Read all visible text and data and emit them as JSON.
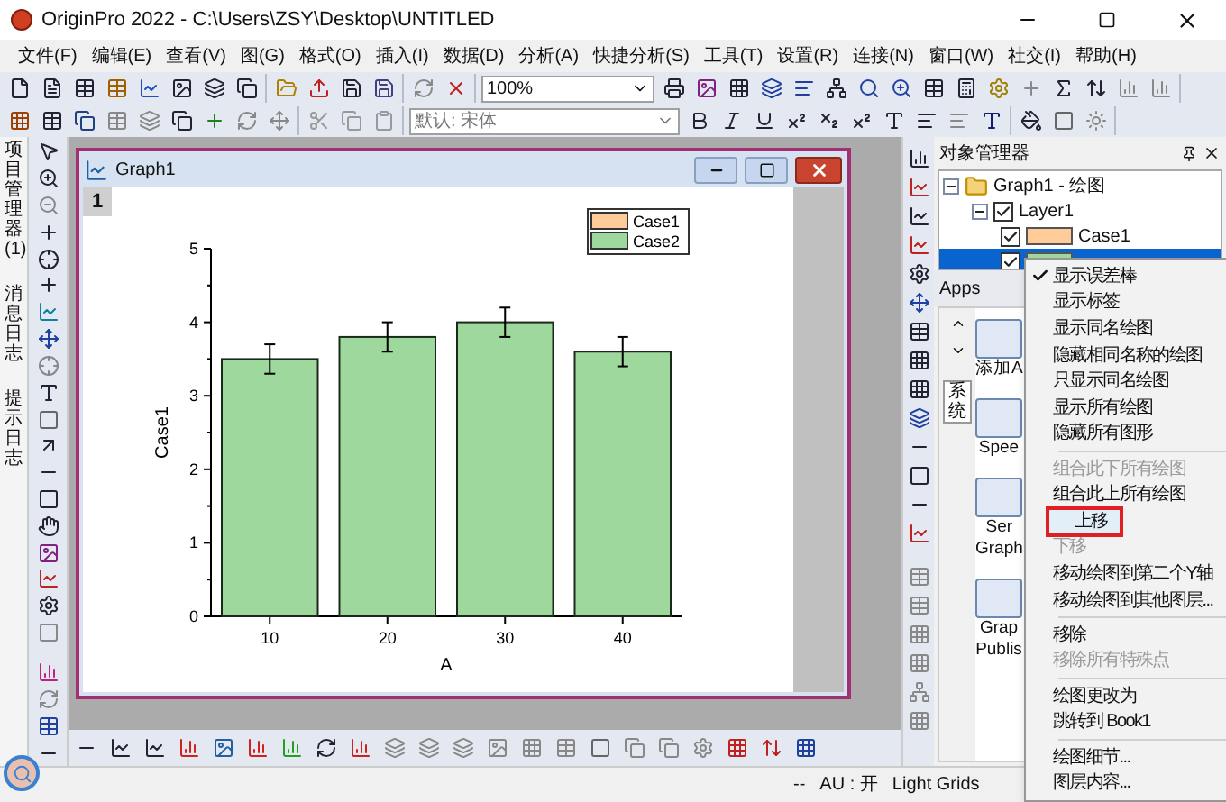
{
  "window": {
    "title": "OriginPro 2022 - C:\\Users\\ZSY\\Desktop\\UNTITLED"
  },
  "menu": [
    "文件(F)",
    "编辑(E)",
    "查看(V)",
    "图(G)",
    "格式(O)",
    "插入(I)",
    "数据(D)",
    "分析(A)",
    "快捷分析(S)",
    "工具(T)",
    "设置(R)",
    "连接(N)",
    "窗口(W)",
    "社交(I)",
    "帮助(H)"
  ],
  "toolbar": {
    "zoom": "100%",
    "font": "默认: 宋体"
  },
  "dock_tabs": [
    "项目管理器 (1)",
    "消息日志",
    "提示日志"
  ],
  "graph_window": {
    "title": "Graph1",
    "layer": "1",
    "chart_data": {
      "type": "bar",
      "xlabel": "A",
      "ylabel": "Case1",
      "categories": [
        "10",
        "20",
        "30",
        "40"
      ],
      "yticks": [
        0,
        1,
        2,
        3,
        4,
        5
      ],
      "ylim": [
        0,
        5
      ],
      "series": [
        {
          "name": "Case1",
          "color": "#ffcc99",
          "values": [
            null,
            null,
            null,
            null
          ]
        },
        {
          "name": "Case2",
          "color": "#9fd89c",
          "values": [
            3.5,
            3.8,
            4.0,
            3.6
          ],
          "errors": [
            0.2,
            0.2,
            0.2,
            0.2
          ]
        }
      ]
    }
  },
  "object_manager": {
    "title": "对象管理器",
    "tree": [
      {
        "label": "Graph1 - 绘图",
        "expanded": true,
        "children": [
          {
            "label": "Layer1",
            "checked": true,
            "expanded": true,
            "children": [
              {
                "label": "Case1",
                "checked": true,
                "color": "#ffcc99",
                "selected": false
              },
              {
                "checked": true,
                "color": "#9fd89c",
                "selected": true
              }
            ]
          }
        ]
      }
    ]
  },
  "apps": {
    "title": "Apps",
    "tab": "系统",
    "items": [
      {
        "lines": [
          "添加A"
        ]
      },
      {
        "lines": [
          "Spee"
        ]
      },
      {
        "lines": [
          "Ser",
          "Graph"
        ]
      },
      {
        "lines": [
          "Grap",
          "Publis"
        ]
      }
    ]
  },
  "context_menu": [
    {
      "kind": "item",
      "label": "显示误差棒",
      "checked": true,
      "disabled": false,
      "selected": false
    },
    {
      "kind": "item",
      "label": "显示标签",
      "checked": false,
      "disabled": false,
      "selected": false
    },
    {
      "kind": "item",
      "label": "显示同名绘图",
      "checked": false,
      "disabled": false,
      "selected": false
    },
    {
      "kind": "item",
      "label": "隐藏相同名称的绘图",
      "checked": false,
      "disabled": false,
      "selected": false
    },
    {
      "kind": "item",
      "label": "只显示同名绘图",
      "checked": false,
      "disabled": false,
      "selected": false
    },
    {
      "kind": "item",
      "label": "显示所有绘图",
      "checked": false,
      "disabled": false,
      "selected": false
    },
    {
      "kind": "item",
      "label": "隐藏所有图形",
      "checked": false,
      "disabled": false,
      "selected": false
    },
    {
      "kind": "separator"
    },
    {
      "kind": "item",
      "label": "组合此下所有绘图",
      "checked": false,
      "disabled": true,
      "selected": false
    },
    {
      "kind": "item",
      "label": "组合此上所有绘图",
      "checked": false,
      "disabled": false,
      "selected": false
    },
    {
      "kind": "item",
      "label": "上移",
      "checked": false,
      "disabled": false,
      "selected": true
    },
    {
      "kind": "item",
      "label": "下移",
      "checked": false,
      "disabled": true,
      "selected": false
    },
    {
      "kind": "item",
      "label": "移动绘图到第二个Y轴",
      "checked": false,
      "disabled": false,
      "selected": false
    },
    {
      "kind": "item",
      "label": "移动绘图到其他图层...",
      "checked": false,
      "disabled": false,
      "selected": false
    },
    {
      "kind": "separator"
    },
    {
      "kind": "item",
      "label": "移除",
      "checked": false,
      "disabled": false,
      "selected": false
    },
    {
      "kind": "item",
      "label": "移除所有特殊点",
      "checked": false,
      "disabled": true,
      "selected": false
    },
    {
      "kind": "separator"
    },
    {
      "kind": "item",
      "label": "绘图更改为",
      "checked": false,
      "disabled": false,
      "selected": false
    },
    {
      "kind": "item",
      "label": "跳转到 Book1",
      "checked": false,
      "disabled": false,
      "selected": false
    },
    {
      "kind": "separator"
    },
    {
      "kind": "item",
      "label": "绘图细节...",
      "checked": false,
      "disabled": false,
      "selected": false
    },
    {
      "kind": "item",
      "label": "图层内容...",
      "checked": false,
      "disabled": false,
      "selected": false
    }
  ],
  "status_bar": [
    "--",
    "AU : 开",
    "Light Grids"
  ]
}
